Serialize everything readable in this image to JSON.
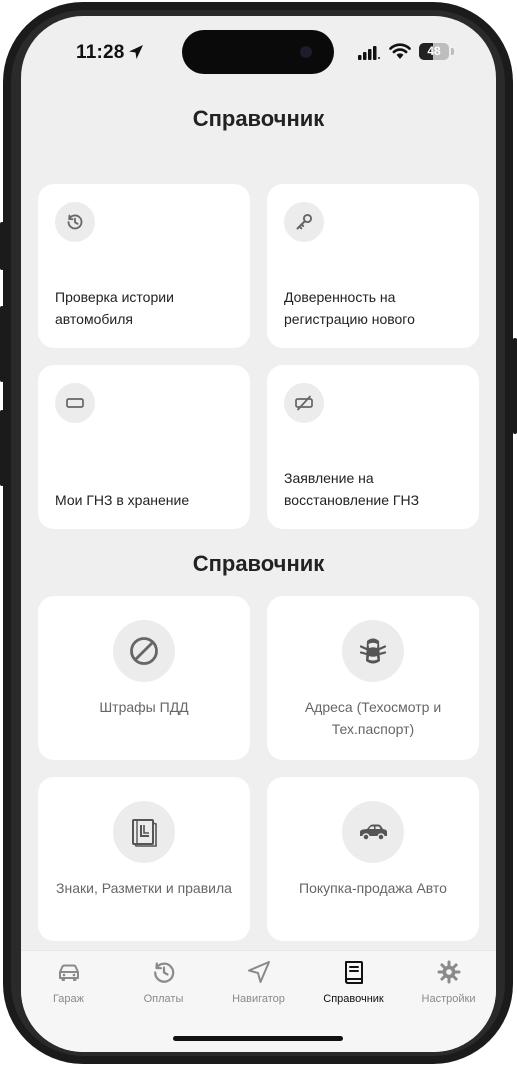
{
  "status_bar": {
    "time": "11:28",
    "battery": "48",
    "battery_level": 0.48
  },
  "section1": {
    "title": "Справочник",
    "cards": [
      {
        "label": "Проверка истории автомобиля",
        "icon": "history-icon"
      },
      {
        "label": "Доверенность на регистрацию нового",
        "icon": "key-icon"
      },
      {
        "label": "Мои ГНЗ в хранение",
        "icon": "plate-icon"
      },
      {
        "label": "Заявление на восстановление ГНЗ",
        "icon": "plate-off-icon"
      }
    ]
  },
  "section2": {
    "title": "Справочник",
    "cards": [
      {
        "label": "Штрафы ПДД",
        "icon": "prohibited-icon"
      },
      {
        "label": "Адреса (Техосмотр и Тех.паспорт)",
        "icon": "car-top-icon"
      },
      {
        "label": "Знаки, Разметки и правила",
        "icon": "rulebook-icon"
      },
      {
        "label": "Покупка-продажа Авто",
        "icon": "car-sale-icon"
      }
    ]
  },
  "tabbar": {
    "items": [
      {
        "label": "Гараж",
        "icon": "car-icon"
      },
      {
        "label": "Оплаты",
        "icon": "history-icon"
      },
      {
        "label": "Навигатор",
        "icon": "navigation-icon"
      },
      {
        "label": "Справочник",
        "icon": "book-icon",
        "active": true
      },
      {
        "label": "Настройки",
        "icon": "gear-icon"
      }
    ]
  },
  "colors": {
    "background": "#efefef",
    "card": "#ffffff",
    "icon_circle": "#ececec",
    "text": "#222222",
    "muted": "#8a8a8a"
  }
}
